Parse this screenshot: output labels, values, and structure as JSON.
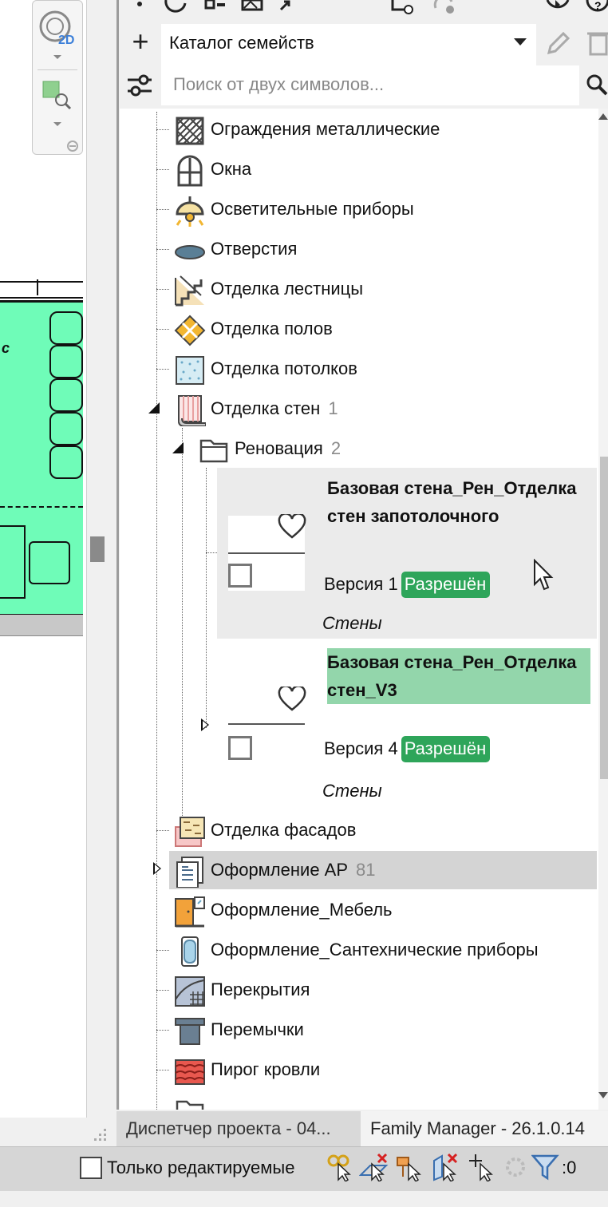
{
  "catalog": {
    "add_label": "+",
    "selected": "Каталог семейств"
  },
  "search": {
    "placeholder": "Поиск от двух символов..."
  },
  "tree": {
    "items": [
      {
        "label": "Ограждения металлические",
        "count": "",
        "icon": "metal-fence-icon"
      },
      {
        "label": "Окна",
        "count": "",
        "icon": "window-icon"
      },
      {
        "label": "Осветительные приборы",
        "count": "",
        "icon": "lamp-icon"
      },
      {
        "label": "Отверстия",
        "count": "",
        "icon": "opening-icon"
      },
      {
        "label": "Отделка лестницы",
        "count": "",
        "icon": "stair-finish-icon"
      },
      {
        "label": "Отделка полов",
        "count": "",
        "icon": "floor-finish-icon"
      },
      {
        "label": "Отделка потолков",
        "count": "",
        "icon": "ceiling-finish-icon"
      },
      {
        "label": "Отделка стен",
        "count": "1",
        "icon": "wall-finish-icon"
      },
      {
        "label": "Реновация",
        "count": "2",
        "icon": "folder-icon"
      },
      {
        "label": "Отделка фасадов",
        "count": "",
        "icon": "facade-finish-icon"
      },
      {
        "label": "Оформление АР",
        "count": "81",
        "icon": "document-icon"
      },
      {
        "label": "Оформление_Мебель",
        "count": "",
        "icon": "furniture-icon"
      },
      {
        "label": "Оформление_Сантехнические приборы",
        "count": "",
        "icon": "bathtub-icon"
      },
      {
        "label": "Перекрытия",
        "count": "",
        "icon": "slab-icon"
      },
      {
        "label": "Перемычки",
        "count": "",
        "icon": "lintel-icon"
      },
      {
        "label": "Пирог кровли",
        "count": "",
        "icon": "roof-icon"
      }
    ]
  },
  "families": [
    {
      "name": "Базовая стена_Рен_Отделка стен запотолочного",
      "version": "Версия 1",
      "status": "Разрешён",
      "category": "Стены"
    },
    {
      "name": "Базовая стена_Рен_Отделка стен_V3",
      "version": "Версия 4",
      "status": "Разрешён",
      "category": "Стены"
    }
  ],
  "tabs": [
    {
      "label": "Диспетчер проекта - 04..."
    },
    {
      "label": "Family Manager - 26.1.0.14"
    }
  ],
  "status_bar": {
    "only_editable_label": "Только редактируемые",
    "filter_count": ":0"
  },
  "plan": {
    "room_text": "с"
  },
  "colors": {
    "status_green": "#2ea55a",
    "highlight_green": "#93d6ab",
    "room_fill": "#6ffcb8"
  }
}
